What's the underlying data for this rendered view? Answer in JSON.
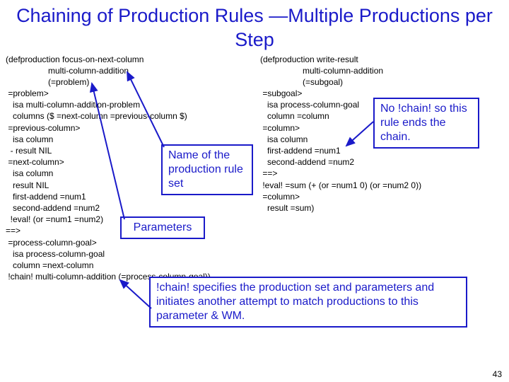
{
  "title": "Chaining of Production Rules —Multiple Productions per Step",
  "left_code": "(defproduction focus-on-next-column\n                  multi-column-addition\n                  (=problem)\n =problem>\n   isa multi-column-addition-problem\n   columns ($ =next-column =previous-column $)\n =previous-column>\n   isa column\n  - result NIL\n =next-column>\n   isa column\n   result NIL\n   first-addend =num1\n   second-addend =num2\n  !eval! (or =num1 =num2)\n==>\n =process-column-goal>\n   isa process-column-goal\n   column =next-column\n !chain! multi-column-addition (=process-column-goal))",
  "right_code": "(defproduction write-result\n                  multi-column-addition\n                  (=subgoal)\n =subgoal>\n   isa process-column-goal\n   column =column\n =column>\n   isa column\n   first-addend =num1\n   second-addend =num2\n ==>\n !eval! =sum (+ (or =num1 0) (or =num2 0))\n =column>\n   result =sum)",
  "box_name": "Name of the production rule set",
  "box_params": "Parameters",
  "box_nochain": "No !chain! so this rule ends the chain.",
  "box_chain": "!chain! specifies the production set and parameters and initiates another attempt to match productions to this parameter & WM.",
  "page_num": "43"
}
